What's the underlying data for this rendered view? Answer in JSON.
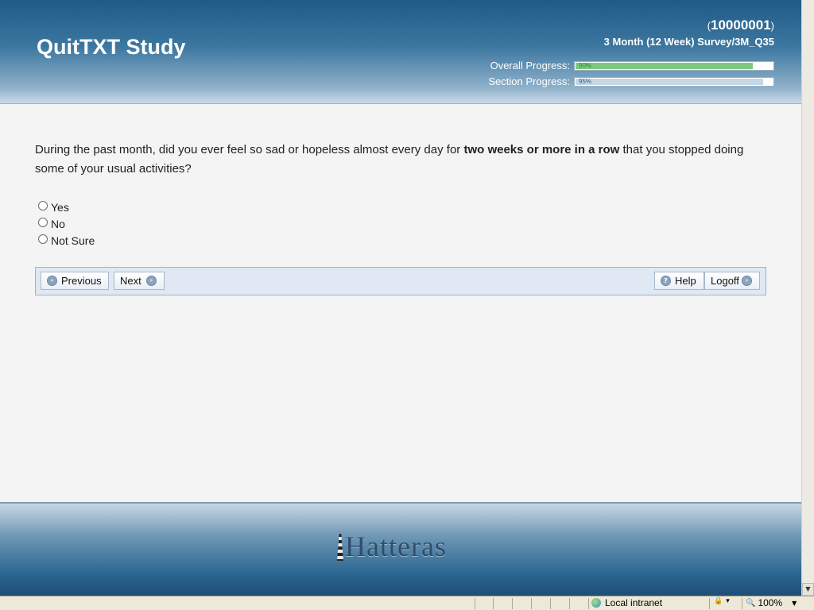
{
  "header": {
    "study_title": "QuitTXT Study",
    "participant_id": "10000001",
    "paren_open": "(",
    "paren_close": ")",
    "survey_path": "3 Month (12 Week) Survey/3M_Q35",
    "overall_progress": {
      "label": "Overall Progress:",
      "value_text": "90%",
      "value": 0.9,
      "color": "#7fc97f",
      "text_color": "#2d8a2d"
    },
    "section_progress": {
      "label": "Section Progress:",
      "value_text": "95%",
      "value": 0.95,
      "color": "#c6d7e6",
      "text_color": "#2b5d8c"
    }
  },
  "question": {
    "text_before": "During the past month, did you ever feel so sad or hopeless almost every day for ",
    "text_bold": "two weeks or more in a row",
    "text_after": " that you stopped doing some of your usual activities?",
    "options": [
      "Yes",
      "No",
      "Not Sure"
    ],
    "selected": null
  },
  "nav": {
    "previous_label": "Previous",
    "next_label": "Next",
    "help_label": "Help",
    "logoff_label": "Logoff",
    "prev_icon": "double-left-arrow-icon",
    "next_icon": "double-right-arrow-icon",
    "help_icon": "question-icon",
    "logoff_icon": "double-right-arrow-icon"
  },
  "footer": {
    "logo_text": "Hatteras",
    "logo_icon": "lighthouse-icon"
  },
  "statusbar": {
    "zone": "Local intranet",
    "zone_icon": "globe-icon",
    "protected_icon": "lock-icon",
    "zoom": "100%",
    "zoom_icon": "magnifier-icon"
  },
  "colors": {
    "header_top": "#1e5a86",
    "header_bottom": "#c9dae7",
    "navbar_bg": "#dfe8f3",
    "page_bg": "#f4f4f4"
  }
}
